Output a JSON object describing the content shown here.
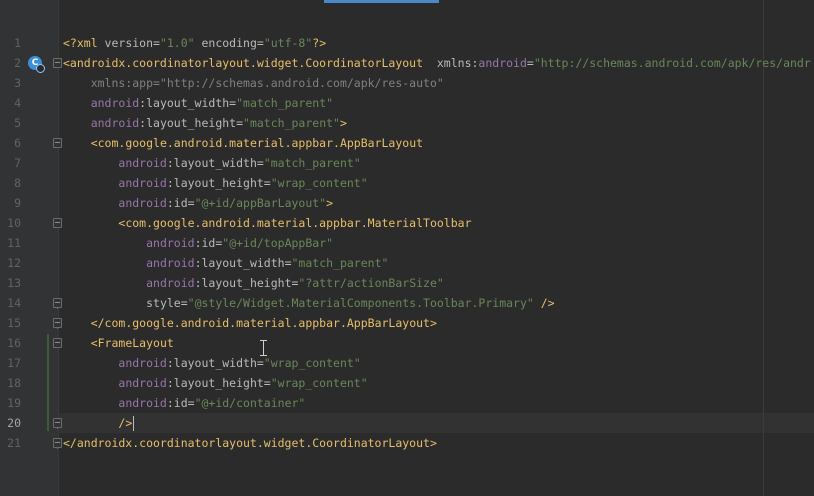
{
  "editor": {
    "file_language": "xml",
    "current_line": 20,
    "colors": {
      "background": "#2b2b2b",
      "gutter": "#313335",
      "tag": "#e8bf6a",
      "namespace": "#9876aa",
      "attribute": "#bababa",
      "value": "#6a8759",
      "line_number": "#606366"
    },
    "gutter_icon": "android-layout-preview-icon",
    "lines": [
      {
        "num": "1",
        "parts": [
          "<?xml",
          " version=",
          "\"1.0\"",
          " encoding=",
          "\"utf-8\"",
          "?>"
        ]
      },
      {
        "num": "2",
        "parts": [
          "<androidx.coordinatorlayout.widget.CoordinatorLayout",
          "  xmlns:",
          "android",
          "=",
          "\"http://schemas.android.com/apk/res/andr"
        ]
      },
      {
        "num": "3",
        "parts": [
          "    xmlns:app=\"http://schemas.android.com/apk/res-auto\""
        ]
      },
      {
        "num": "4",
        "parts": [
          "    ",
          "android",
          ":layout_width=",
          "\"match_parent\""
        ]
      },
      {
        "num": "5",
        "parts": [
          "    ",
          "android",
          ":layout_height=",
          "\"match_parent\"",
          ">"
        ]
      },
      {
        "num": "6",
        "parts": [
          "    ",
          "<com.google.android.material.appbar.AppBarLayout"
        ]
      },
      {
        "num": "7",
        "parts": [
          "        ",
          "android",
          ":layout_width=",
          "\"match_parent\""
        ]
      },
      {
        "num": "8",
        "parts": [
          "        ",
          "android",
          ":layout_height=",
          "\"wrap_content\""
        ]
      },
      {
        "num": "9",
        "parts": [
          "        ",
          "android",
          ":id=",
          "\"@+id/appBarLayout\"",
          ">"
        ]
      },
      {
        "num": "10",
        "parts": [
          "        ",
          "<com.google.android.material.appbar.MaterialToolbar"
        ]
      },
      {
        "num": "11",
        "parts": [
          "            ",
          "android",
          ":id=",
          "\"@+id/topAppBar\""
        ]
      },
      {
        "num": "12",
        "parts": [
          "            ",
          "android",
          ":layout_width=",
          "\"match_parent\""
        ]
      },
      {
        "num": "13",
        "parts": [
          "            ",
          "android",
          ":layout_height=",
          "\"?attr/actionBarSize\""
        ]
      },
      {
        "num": "14",
        "parts": [
          "            ",
          "style=",
          "\"@style/Widget.MaterialComponents.Toolbar.Primary\"",
          " />"
        ]
      },
      {
        "num": "15",
        "parts": [
          "    ",
          "</com.google.android.material.appbar.AppBarLayout>"
        ]
      },
      {
        "num": "16",
        "parts": [
          "    ",
          "<FrameLayout"
        ]
      },
      {
        "num": "17",
        "parts": [
          "        ",
          "android",
          ":layout_width=",
          "\"wrap_content\""
        ]
      },
      {
        "num": "18",
        "parts": [
          "        ",
          "android",
          ":layout_height=",
          "\"wrap_content\""
        ]
      },
      {
        "num": "19",
        "parts": [
          "        ",
          "android",
          ":id=",
          "\"@+id/container\""
        ]
      },
      {
        "num": "20",
        "parts": [
          "        ",
          "/>"
        ]
      },
      {
        "num": "21",
        "parts": [
          "</androidx.coordinatorlayout.widget.CoordinatorLayout>"
        ]
      }
    ]
  }
}
